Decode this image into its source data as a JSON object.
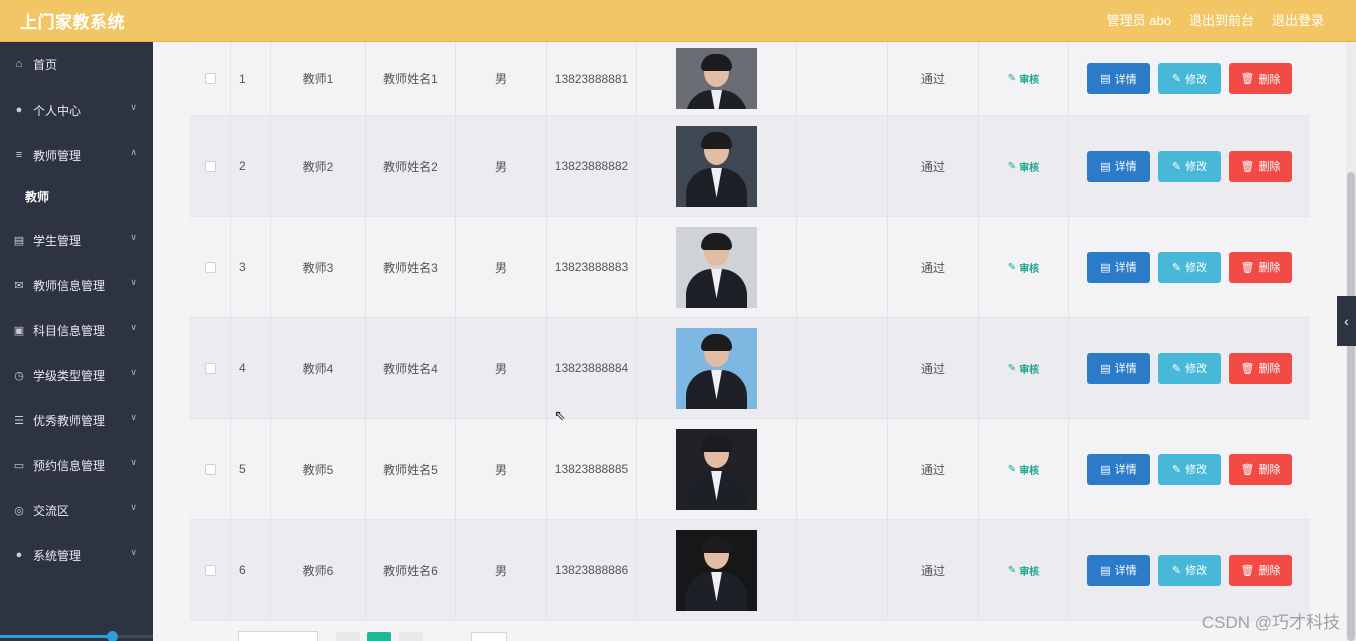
{
  "header": {
    "app_title": "上门家教系统",
    "admin_label": "管理员 abo",
    "front_link": "退出到前台",
    "logout_link": "退出登录"
  },
  "sidebar": {
    "items": [
      {
        "label": "首页",
        "icon": "home-icon"
      },
      {
        "label": "个人中心",
        "icon": "user-icon"
      },
      {
        "label": "教师管理",
        "icon": "list-icon"
      },
      {
        "label": "教师",
        "icon": ""
      },
      {
        "label": "学生管理",
        "icon": "chart-icon"
      },
      {
        "label": "教师信息管理",
        "icon": "mail-icon"
      },
      {
        "label": "科目信息管理",
        "icon": "chat-icon"
      },
      {
        "label": "学级类型管理",
        "icon": "clock-icon"
      },
      {
        "label": "优秀教师管理",
        "icon": "sliders-icon"
      },
      {
        "label": "预约信息管理",
        "icon": "message-icon"
      },
      {
        "label": "交流区",
        "icon": "compass-icon"
      },
      {
        "label": "系统管理",
        "icon": "location-icon"
      }
    ]
  },
  "table": {
    "rows": [
      {
        "index": "1",
        "account": "教师1",
        "name": "教师姓名1",
        "sex": "男",
        "phone": "13823888881",
        "status": "通过"
      },
      {
        "index": "2",
        "account": "教师2",
        "name": "教师姓名2",
        "sex": "男",
        "phone": "13823888882",
        "status": "通过"
      },
      {
        "index": "3",
        "account": "教师3",
        "name": "教师姓名3",
        "sex": "男",
        "phone": "13823888883",
        "status": "通过"
      },
      {
        "index": "4",
        "account": "教师4",
        "name": "教师姓名4",
        "sex": "男",
        "phone": "13823888884",
        "status": "通过"
      },
      {
        "index": "5",
        "account": "教师5",
        "name": "教师姓名5",
        "sex": "男",
        "phone": "13823888885",
        "status": "通过"
      },
      {
        "index": "6",
        "account": "教师6",
        "name": "教师姓名6",
        "sex": "男",
        "phone": "13823888886",
        "status": "通过"
      }
    ],
    "audit_label": "审核",
    "detail_label": "详情",
    "edit_label": "修改",
    "delete_label": "删除"
  },
  "watermark": "CSDN @巧才科技",
  "colors": {
    "topbar": "#f2c664",
    "sidebar": "#2d3340",
    "detail": "#2b7bc8",
    "edit": "#48b8d8",
    "delete": "#f24a44",
    "audit": "#20a58e"
  }
}
